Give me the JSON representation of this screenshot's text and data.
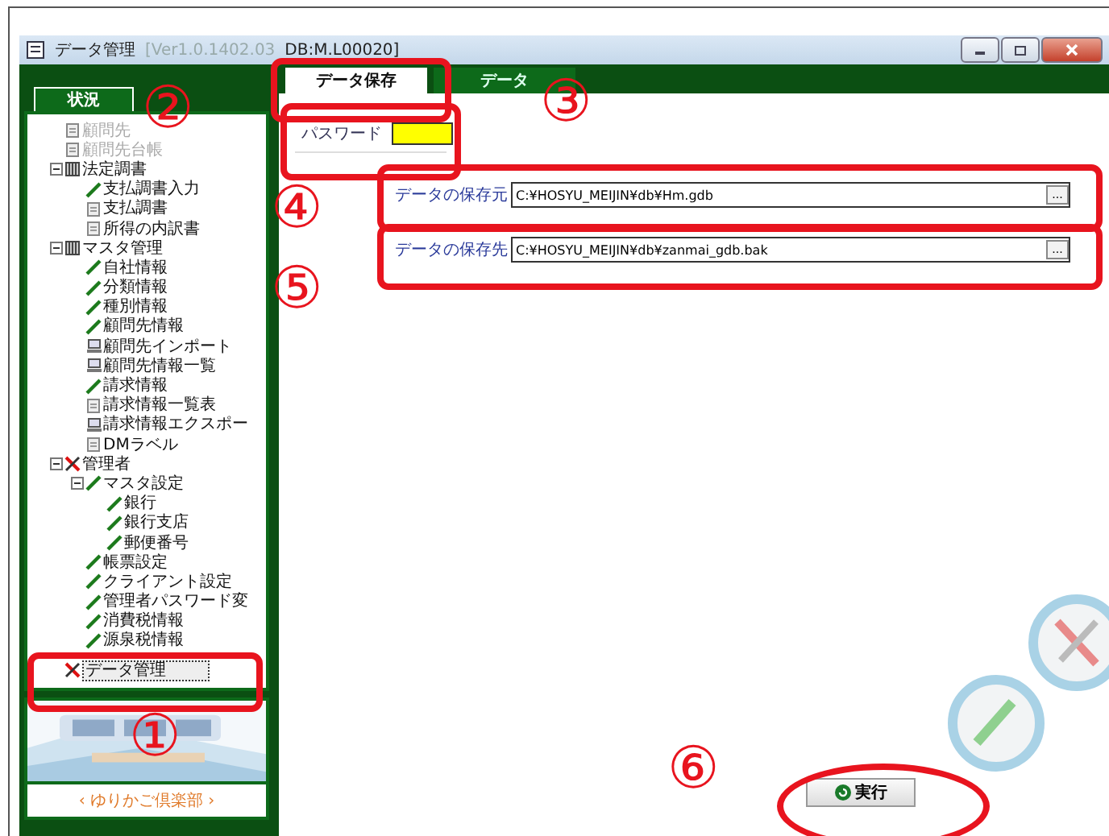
{
  "window": {
    "title": "データ管理",
    "version": "[Ver1.0.1402.03",
    "db": "DB:M.L00020]"
  },
  "sidebar": {
    "tab": "状況",
    "tree": [
      {
        "label": "顧問先",
        "kind": "doc",
        "disabled": true,
        "selected": false
      },
      {
        "label": "顧問先台帳",
        "kind": "doc",
        "disabled": true,
        "selected": false
      },
      {
        "label": "法定調書",
        "kind": "book",
        "disabled": false,
        "selected": false,
        "expanded": true,
        "children": [
          {
            "label": "支払調書入力",
            "kind": "pencil",
            "disabled": false,
            "selected": false
          },
          {
            "label": "支払調書",
            "kind": "doc",
            "disabled": false,
            "selected": false
          },
          {
            "label": "所得の内訳書",
            "kind": "doc",
            "disabled": false,
            "selected": false
          }
        ]
      },
      {
        "label": "マスタ管理",
        "kind": "book",
        "disabled": false,
        "selected": false,
        "expanded": true,
        "children": [
          {
            "label": "自社情報",
            "kind": "pencil",
            "disabled": false,
            "selected": false
          },
          {
            "label": "分類情報",
            "kind": "pencil",
            "disabled": false,
            "selected": false
          },
          {
            "label": "種別情報",
            "kind": "pencil",
            "disabled": false,
            "selected": false
          },
          {
            "label": "顧問先情報",
            "kind": "pencil",
            "disabled": false,
            "selected": false
          },
          {
            "label": "顧問先インポート",
            "kind": "pc",
            "disabled": false,
            "selected": false
          },
          {
            "label": "顧問先情報一覧",
            "kind": "pc",
            "disabled": false,
            "selected": false
          },
          {
            "label": "請求情報",
            "kind": "pencil",
            "disabled": false,
            "selected": false
          },
          {
            "label": "請求情報一覧表",
            "kind": "doc",
            "disabled": false,
            "selected": false
          },
          {
            "label": "請求情報エクスポー",
            "kind": "pc",
            "disabled": false,
            "selected": false
          },
          {
            "label": "DMラベル",
            "kind": "doc",
            "disabled": false,
            "selected": false
          }
        ]
      },
      {
        "label": "管理者",
        "kind": "x",
        "disabled": false,
        "selected": false,
        "expanded": true,
        "children": [
          {
            "label": "マスタ設定",
            "kind": "pencil",
            "disabled": false,
            "selected": false,
            "expanded": true,
            "children": [
              {
                "label": "銀行",
                "kind": "pencil",
                "disabled": false,
                "selected": false
              },
              {
                "label": "銀行支店",
                "kind": "pencil",
                "disabled": false,
                "selected": false
              },
              {
                "label": "郵便番号",
                "kind": "pencil",
                "disabled": false,
                "selected": false
              }
            ]
          },
          {
            "label": "帳票設定",
            "kind": "pencil",
            "disabled": false,
            "selected": false
          },
          {
            "label": "クライアント設定",
            "kind": "pencil",
            "disabled": false,
            "selected": false
          },
          {
            "label": "管理者パスワード変",
            "kind": "pencil",
            "disabled": false,
            "selected": false
          },
          {
            "label": "消費税情報",
            "kind": "pencil",
            "disabled": false,
            "selected": false
          },
          {
            "label": "源泉税情報",
            "kind": "pencil",
            "disabled": false,
            "selected": false
          }
        ]
      },
      {
        "label": "データ管理",
        "kind": "x",
        "disabled": false,
        "selected": true
      }
    ],
    "banner": {
      "kind": "picture",
      "link": "‹ ゆりかご倶楽部 ›"
    }
  },
  "tabs": [
    {
      "label": "データ保存",
      "selected": true
    },
    {
      "label": "データ",
      "selected": false
    }
  ],
  "password": {
    "label": "パスワード"
  },
  "paths": [
    {
      "label": "データの保存元",
      "value": "C:¥HOSYU_MEIJIN¥db¥Hm.gdb",
      "browse": "..."
    },
    {
      "label": "データの保存先",
      "value": "C:¥HOSYU_MEIJIN¥db¥zanmai_gdb.bak",
      "browse": "..."
    }
  ],
  "execute": {
    "label": "実行"
  },
  "annotations": [
    {
      "kind": "frame"
    },
    {
      "kind": "frame"
    },
    {
      "kind": "frame"
    },
    {
      "kind": "frame"
    },
    {
      "kind": "frame"
    },
    {
      "kind": "ellipse"
    },
    {
      "kind": "number",
      "label": "①"
    },
    {
      "kind": "number",
      "label": "②"
    },
    {
      "kind": "number",
      "label": "③"
    },
    {
      "kind": "number",
      "label": "④"
    },
    {
      "kind": "number",
      "label": "⑤"
    },
    {
      "kind": "number",
      "label": "⑥"
    }
  ]
}
